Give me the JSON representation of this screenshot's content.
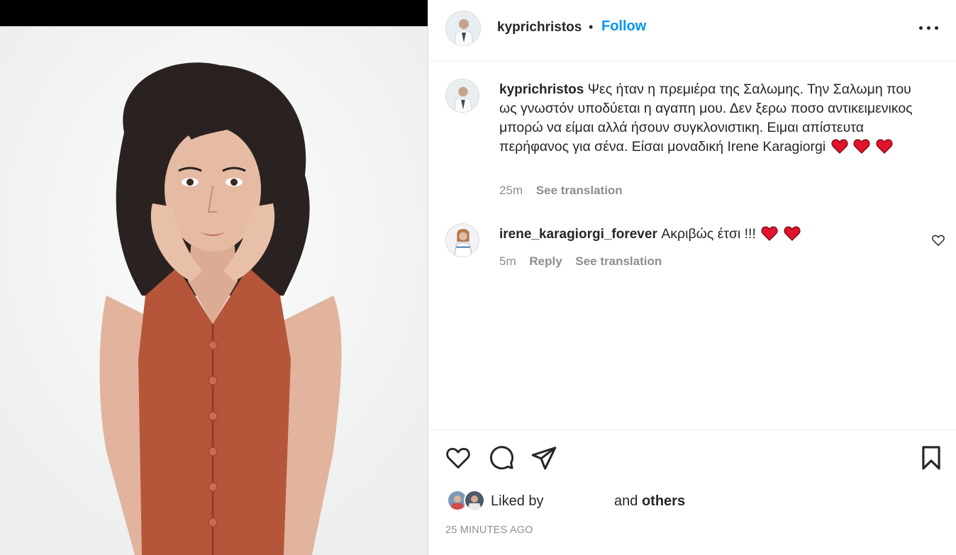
{
  "header": {
    "username": "kyprichristos",
    "separator": "•",
    "follow_label": "Follow",
    "more_icon": "more-options-icon"
  },
  "caption": {
    "username": "kyprichristos",
    "text": "Ψες ήταν η πρεμιέρα της Σαλωμης. Την Σαλωμη που ως γνωστόν υποδύεται η αγαπη μου. Δεν ξερω ποσο αντικειμενικος μπορώ να είμαι αλλά ήσουν συγκλονιστικη. Ειμαι απίστευτα περήφανος για σένα. Είσαι μοναδική Irene Karagiorgi",
    "time": "25m",
    "see_translation": "See translation"
  },
  "comment": {
    "username": "irene_karagiorgi_forever",
    "text": "Ακριβώς έτσι !!!",
    "time": "5m",
    "reply": "Reply",
    "see_translation": "See translation"
  },
  "likes": {
    "liked_by": "Liked by",
    "and": "and",
    "others": "others"
  },
  "timestamp": "25 MINUTES AGO",
  "colors": {
    "accent": "#0095f6",
    "heart": "#e0142a",
    "dress": "#b5563a"
  }
}
